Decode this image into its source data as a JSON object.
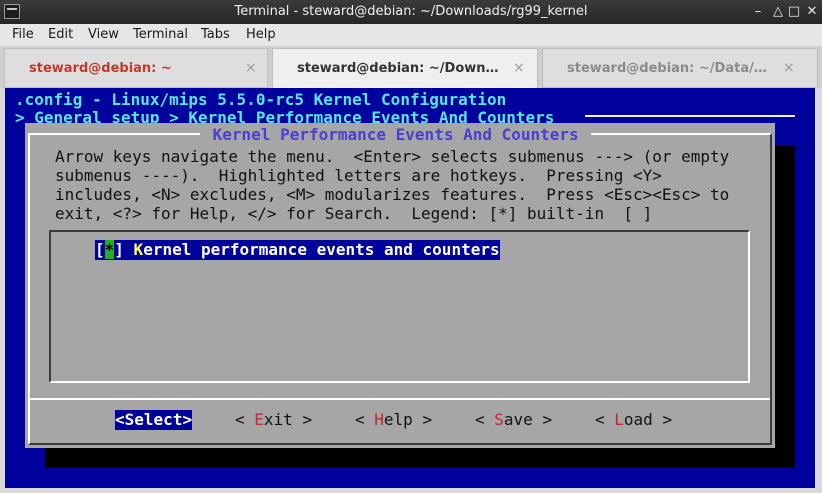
{
  "window": {
    "title": "Terminal - steward@debian: ~/Downloads/rg99_kernel",
    "controls": {
      "minimize": "–",
      "maximize": "△",
      "restore": "□",
      "close": "✕"
    }
  },
  "menubar": {
    "items": [
      "File",
      "Edit",
      "View",
      "Terminal",
      "Tabs",
      "Help"
    ]
  },
  "tabs": [
    {
      "label": "steward@debian: ~",
      "active": false,
      "color": "#c0392b"
    },
    {
      "label": "steward@debian: ~/Down…",
      "active": true,
      "color": "#333333"
    },
    {
      "label": "steward@debian: ~/Data/…",
      "active": false,
      "color": "#8a8a8a"
    }
  ],
  "tab_close": "×",
  "terminal": {
    "header1": ".config - Linux/mips 5.5.0-rc5 Kernel Configuration",
    "header2": "> General setup > Kernel Performance Events And Counters ",
    "dialog_title": " Kernel Performance Events And Counters ",
    "help_lines": [
      "Arrow keys navigate the menu.  <Enter> selects submenus ---> (or empty",
      "submenus ----).  Highlighted letters are hotkeys.  Pressing <Y>",
      "includes, <N> excludes, <M> modularizes features.  Press <Esc><Esc> to",
      "exit, <?> for Help, </> for Search.  Legend: [*] built-in  [ ]"
    ],
    "item": {
      "open": "[",
      "mark": "*",
      "close": "] ",
      "hotkey": "K",
      "rest": "ernel performance events and counters"
    },
    "buttons": [
      {
        "pre": "<",
        "hot": "S",
        "post": "elect>",
        "selected": true
      },
      {
        "pre": "< ",
        "hot": "E",
        "post": "xit >",
        "selected": false
      },
      {
        "pre": "< ",
        "hot": "H",
        "post": "elp >",
        "selected": false
      },
      {
        "pre": "< ",
        "hot": "S",
        "post": "ave >",
        "selected": false
      },
      {
        "pre": "< ",
        "hot": "L",
        "post": "oad >",
        "selected": false
      }
    ]
  },
  "colors": {
    "terminal_bg": "#00009c",
    "dialog_bg": "#a6a6a6",
    "header_text": "#55e6e6",
    "title_text": "#4a3fd0",
    "hotkey_red": "#c02a2a",
    "check_green": "#22b022"
  }
}
